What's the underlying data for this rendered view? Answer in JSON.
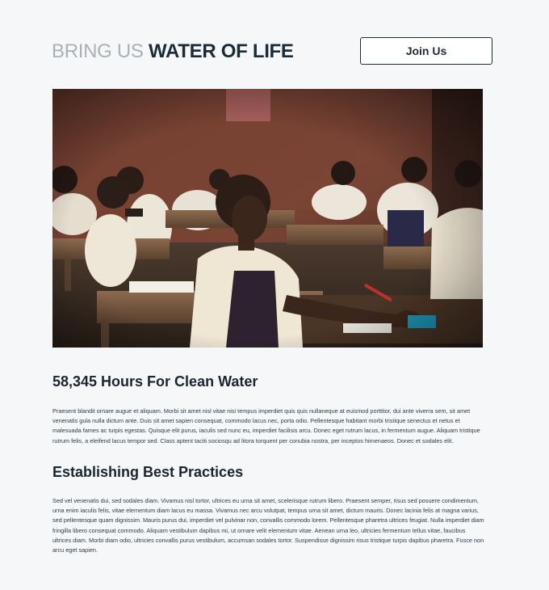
{
  "header": {
    "logo_light": "BRING US ",
    "logo_bold": "WATER OF LIFE",
    "join_label": "Join Us"
  },
  "hero": {
    "alt": "Students sitting at wooden desks in a classroom"
  },
  "sections": [
    {
      "title": "58,345 Hours For Clean Water",
      "body": "Praesent blandit ornare augue et aliquam. Morbi sit amet nisl vitae nisi tempus imperdiet quis quis nullaneque at euismod porttitor, dui ante viverra sem, sit amet venenatis gula nulla dictum ante. Duis sit amet sapien consequat, commodo lacus nec, porta odio. Pellentesque habitant morbi tristique senectus et netus et malesuada fames ac turpis egestas. Quisque elit purus, iaculis sed nunc eu, imperdiet facilisis arcu. Donec eget rutrum lacus, in fermentum augue. Aliquam tristique rutrum felis, a eleifend lacus tempor sed. Class aptent taciti sociosqu ad litora torquent per conubia nostra, per inceptos himenaeos. Donec et sodales elit."
    },
    {
      "title": "Establishing Best Practices",
      "body": "Sed vel venenatis dui, sed sodales diam. Vivamus nisl tortor, ultrices eu urna sit amet, scelerisque rutrum libero. Praesent semper, risus sed posuere condimentum, urna enim iaculis felis, vitae elementum diam lacus eu massa. Vivamus nec arcu volutpat, tempus urna sit amet, dictum mauris. Donec lacinia felis at magna varius, sed pellentesque quam dignissim. Mauris purus dui, imperdiet vel pulvinar non, convallis commodo lorem. Pellentesque pharetra ultrices feugiat. Nulla imperdiet diam fringilla libero consequat commodo. Aliquam vestibulum dapibus mi, ut ornare velit elementum vitae. Aenean urna leo, ultricies fermentum tellus vitae, faucibus ultrices diam. Morbi diam odio, ultricies convallis purus vestibulum, accumsan sodales tortor. Suspendisse dignissim risus tristique turpis dapibus pharetra. Fusce non arcu eget sapien."
    }
  ]
}
